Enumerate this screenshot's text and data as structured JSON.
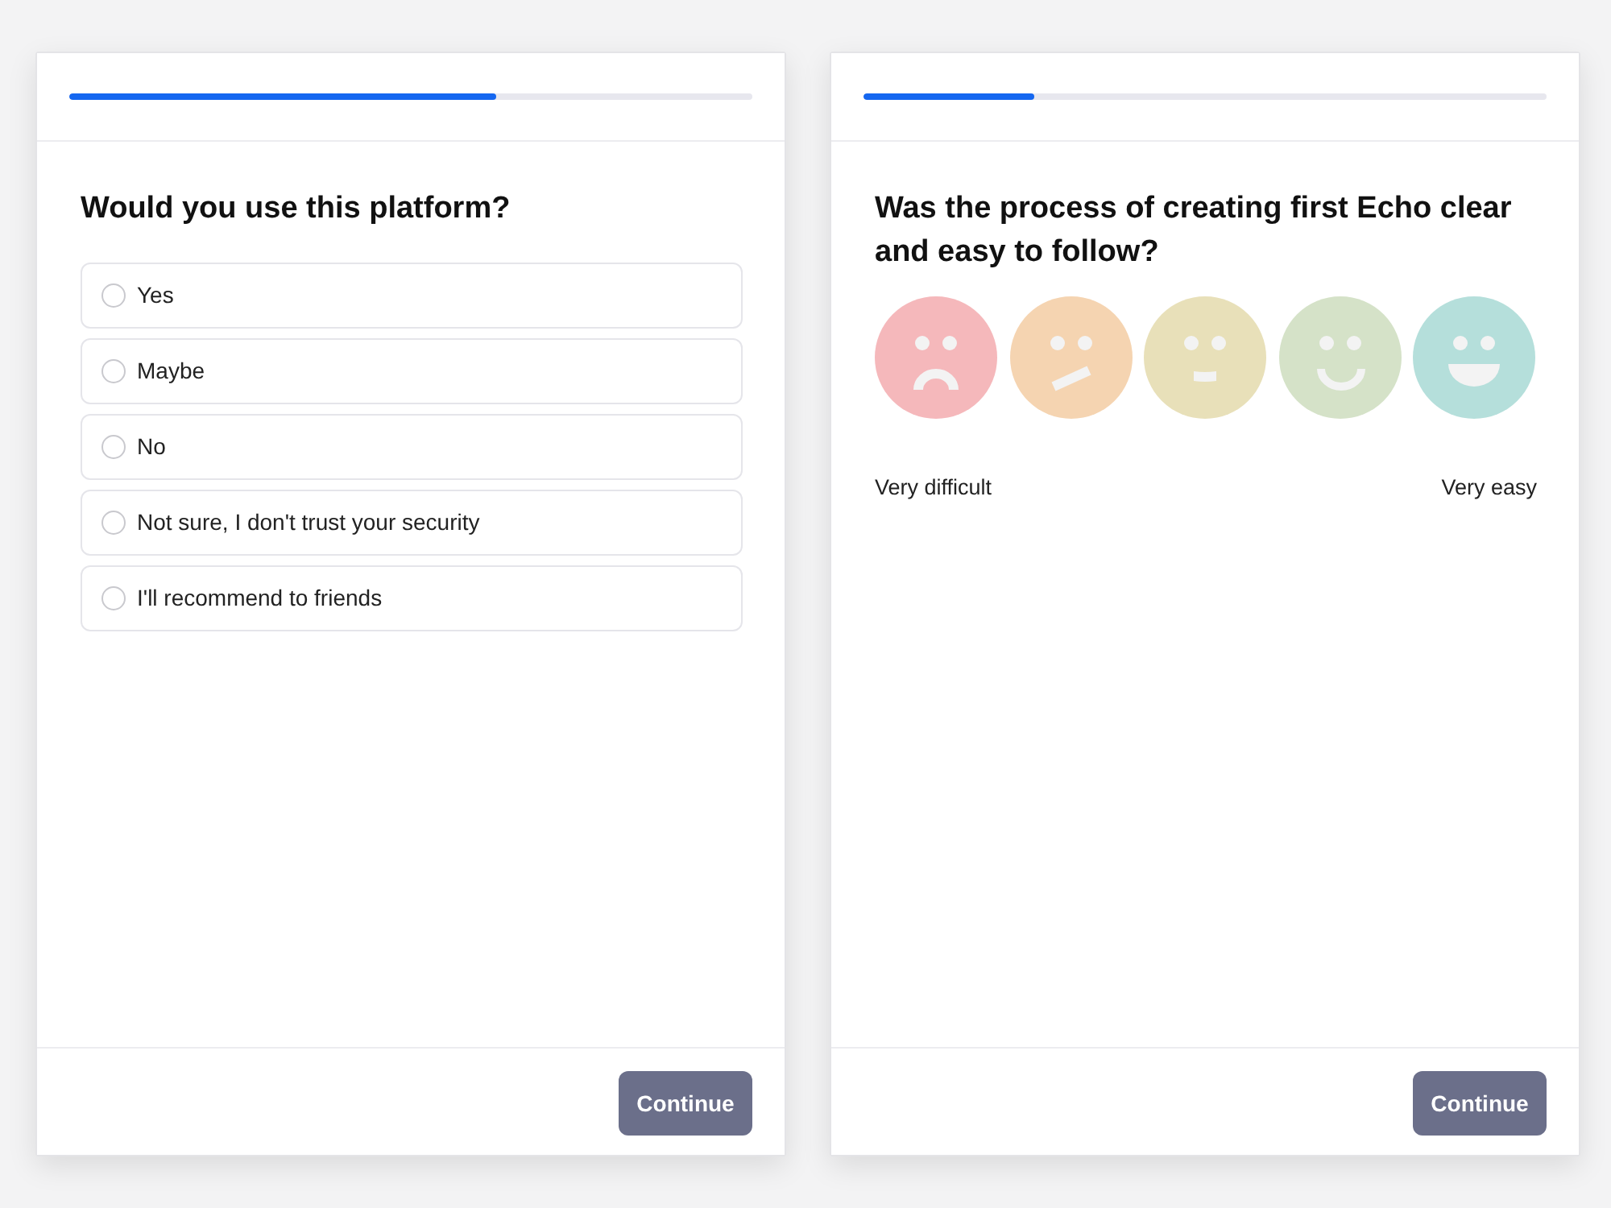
{
  "screens": [
    {
      "kind": "choice",
      "progress": {
        "level": 0.625
      },
      "question": "Would you use this platform?",
      "options": [
        {
          "label": "Yes",
          "selected": false
        },
        {
          "label": "Maybe",
          "selected": false
        },
        {
          "label": "No",
          "selected": false
        },
        {
          "label": "Not sure, I don't trust your security",
          "selected": false
        },
        {
          "label": "I'll recommend to friends",
          "selected": false
        }
      ],
      "button": "Continue"
    },
    {
      "kind": "rating",
      "progress": {
        "level": 0.25
      },
      "question": "Was the process of creating first Echo clear and easy to follow?",
      "faces": [
        {
          "kind": "sad",
          "color": "#f5b8bb",
          "selected": false
        },
        {
          "kind": "skeptical",
          "color": "#f5d4b1",
          "selected": false
        },
        {
          "kind": "neutral",
          "color": "#e8e0b9",
          "selected": false
        },
        {
          "kind": "smiling",
          "color": "#d5e2c8",
          "selected": false
        },
        {
          "kind": "grinning",
          "color": "#b5dfdb",
          "selected": false
        }
      ],
      "scale": {
        "low": "Very difficult",
        "high": "Very easy"
      },
      "button": "Continue"
    }
  ]
}
